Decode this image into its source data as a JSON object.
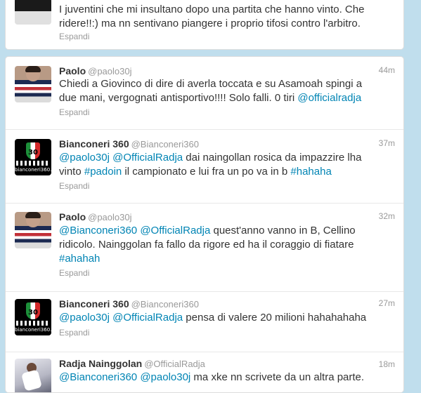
{
  "top_tweet": {
    "text": "I juventini che mi insultano dopo una partita che hanno vinto. Che ridere!!:) ma nn sentivano piangere i proprio tifosi contro l'arbitro.",
    "expand": "Espandi"
  },
  "tweets": [
    {
      "name": "Paolo",
      "handle": "@paolo30j",
      "time": "44m",
      "text_plain": "Chiedi a Giovinco di dire di averla toccata e su Asamoah spingi a due mani, vergognati antisportivo!!!! Solo falli. 0 tiri ",
      "mention_1": "@officialradja",
      "expand": "Espandi"
    },
    {
      "name": "Bianconeri 360",
      "handle": "@Bianconeri360",
      "time": "37m",
      "mention_1": "@paolo30j",
      "mention_2": "@OfficialRadja",
      "text_a": " dai naingollan rosica da impazzire lha vinto ",
      "hashtag_1": "#padoin",
      "text_b": " il campionato e lui fra un po va in b ",
      "hashtag_2": "#hahaha",
      "expand": "Espandi"
    },
    {
      "name": "Paolo",
      "handle": "@paolo30j",
      "time": "32m",
      "mention_1": "@Bianconeri360",
      "mention_2": "@OfficialRadja",
      "text_a": " quest'anno vanno in B, Cellino ridicolo. Nainggolan fa fallo da rigore ed ha il coraggio di fiatare ",
      "hashtag_1": "#ahahah",
      "expand": "Espandi"
    },
    {
      "name": "Bianconeri 360",
      "handle": "@Bianconeri360",
      "time": "27m",
      "mention_1": "@paolo30j",
      "mention_2": "@OfficialRadja",
      "text_a": " pensa di valere 20 milioni hahahahaha",
      "expand": "Espandi"
    },
    {
      "name": "Radja Nainggolan",
      "handle": "@OfficialRadja",
      "time": "18m",
      "mention_1": "@Bianconeri360",
      "mention_2": "@paolo30j",
      "text_a": " ma xke nn scrivete da un altra parte."
    }
  ],
  "avatar_text": {
    "bianconeri_number": "30",
    "bianconeri_site": "bianconeri360.it"
  },
  "colors": {
    "background": "#c0deed",
    "link": "#0084b4",
    "text": "#333333",
    "muted": "#999999"
  }
}
